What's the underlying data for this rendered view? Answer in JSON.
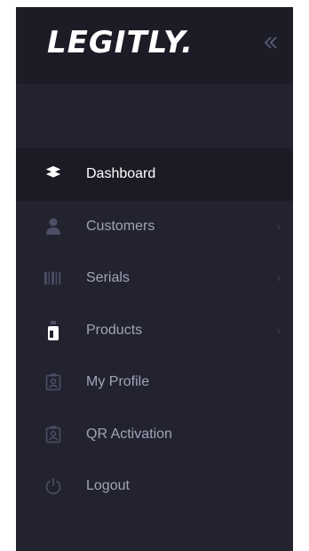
{
  "brand": {
    "logo_text": "LEGITLY."
  },
  "header": {
    "collapse_icon": "double-chevron-left-icon"
  },
  "nav": {
    "items": [
      {
        "label": "Dashboard",
        "icon": "layers-icon",
        "active": true,
        "has_submenu": false
      },
      {
        "label": "Customers",
        "icon": "user-icon",
        "active": false,
        "has_submenu": true
      },
      {
        "label": "Serials",
        "icon": "barcode-icon",
        "active": false,
        "has_submenu": true
      },
      {
        "label": "Products",
        "icon": "bottle-icon",
        "active": false,
        "has_submenu": true
      },
      {
        "label": "My Profile",
        "icon": "id-badge-icon",
        "active": false,
        "has_submenu": false
      },
      {
        "label": "QR Activation",
        "icon": "id-badge-icon",
        "active": false,
        "has_submenu": false
      },
      {
        "label": "Logout",
        "icon": "power-icon",
        "active": false,
        "has_submenu": false
      }
    ]
  },
  "colors": {
    "sidebar_bg": "#232330",
    "brand_bg": "#1c1c27",
    "active_bg": "#1b1b25",
    "icon": "#4e4e66",
    "label": "#a2a3b7",
    "active_label": "#ffffff"
  }
}
